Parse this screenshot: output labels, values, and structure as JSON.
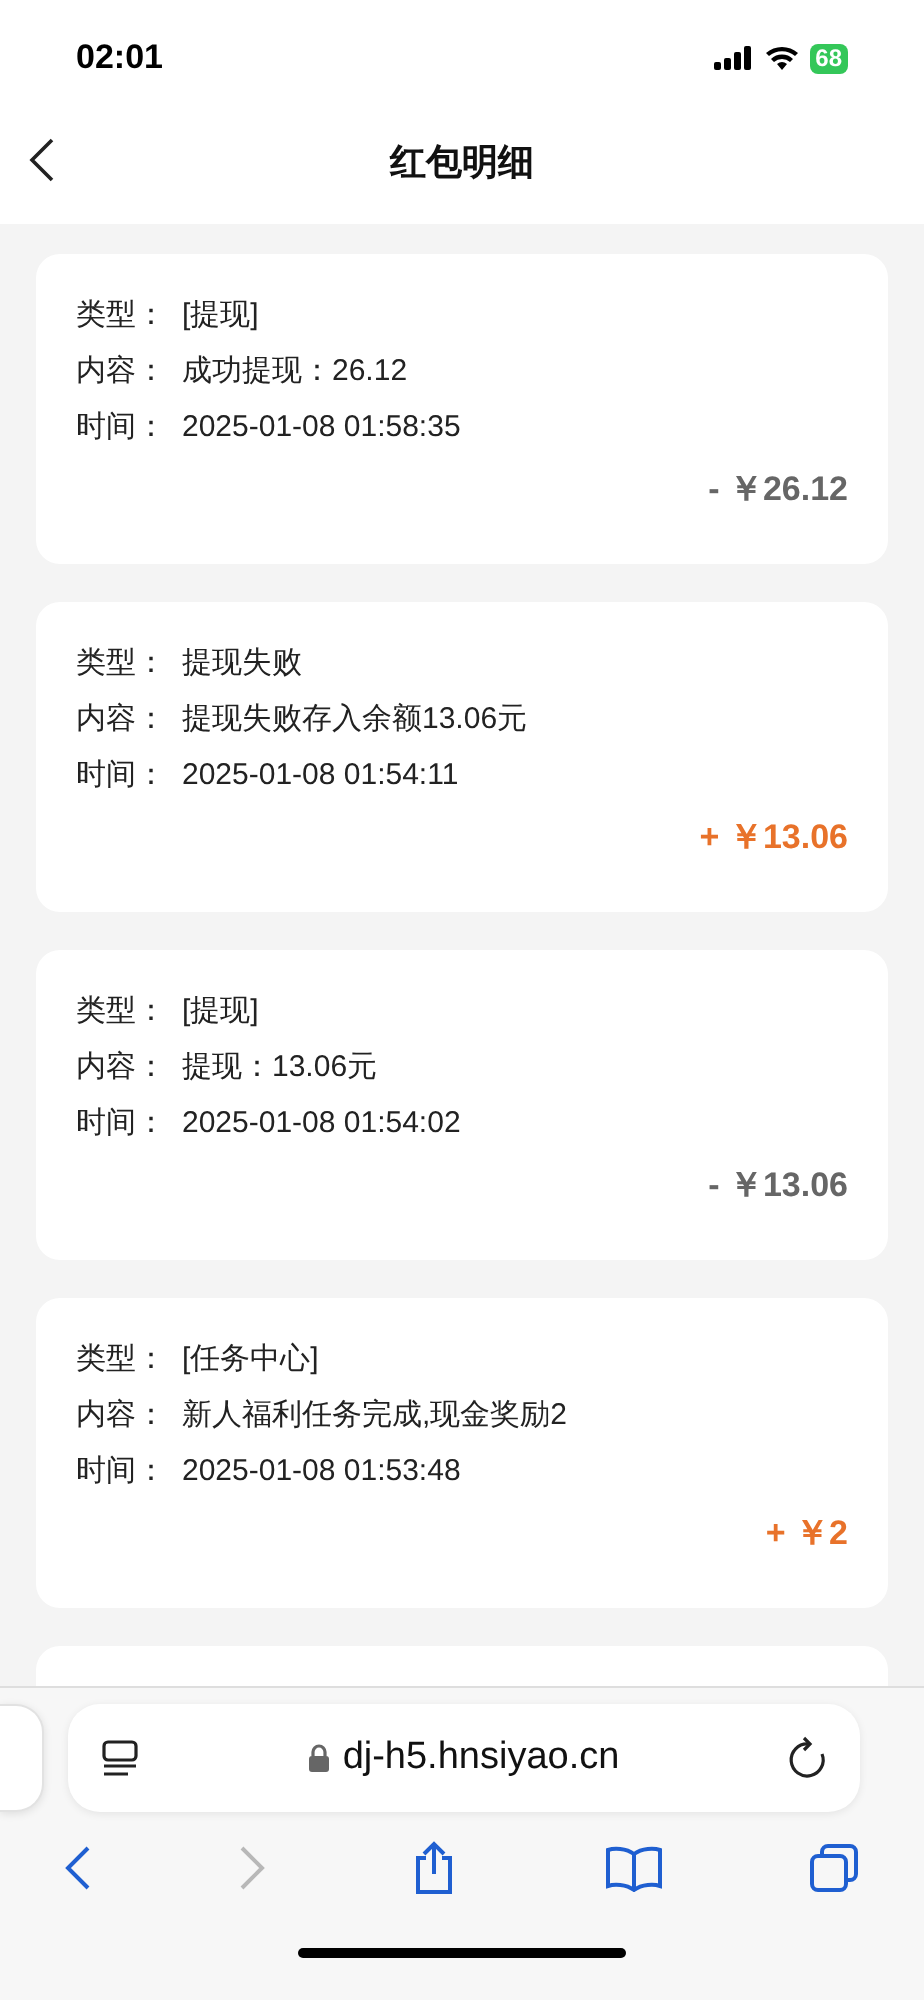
{
  "status_bar": {
    "time": "02:01",
    "battery": "68"
  },
  "nav": {
    "title": "红包明细"
  },
  "records": [
    {
      "type_label": "类型：",
      "type": "[提现]",
      "content_label": "内容：",
      "content": "成功提现：26.12",
      "time_label": "时间：",
      "time": "2025-01-08 01:58:35",
      "amount": "- ￥26.12",
      "kind": "debit"
    },
    {
      "type_label": "类型：",
      "type": "提现失败",
      "content_label": "内容：",
      "content": "提现失败存入余额13.06元",
      "time_label": "时间：",
      "time": "2025-01-08 01:54:11",
      "amount": "+ ￥13.06",
      "kind": "credit"
    },
    {
      "type_label": "类型：",
      "type": "[提现]",
      "content_label": "内容：",
      "content": "提现：13.06元",
      "time_label": "时间：",
      "time": "2025-01-08 01:54:02",
      "amount": "- ￥13.06",
      "kind": "debit"
    },
    {
      "type_label": "类型：",
      "type": "[任务中心]",
      "content_label": "内容：",
      "content": "新人福利任务完成,现金奖励2",
      "time_label": "时间：",
      "time": "2025-01-08 01:53:48",
      "amount": "+ ￥2",
      "kind": "credit"
    }
  ],
  "browser": {
    "url": "dj-h5.hnsiyao.cn"
  }
}
